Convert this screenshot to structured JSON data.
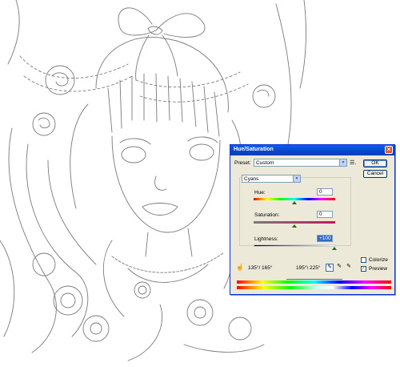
{
  "dialog": {
    "title": "Hue/Saturation",
    "preset_label": "Preset:",
    "preset_value": "Custom",
    "ok_label": "OK",
    "cancel_label": "Cancel",
    "channel_value": "Cyans",
    "hue_label": "Hue:",
    "hue_value": "0",
    "saturation_label": "Saturation:",
    "saturation_value": "0",
    "lightness_label": "Lightness:",
    "lightness_value": "+100",
    "colorize_label": "Colorize",
    "preview_label": "Preview",
    "range_left": "135°/ 165°",
    "range_right": "195°\\ 225°",
    "colorize_checked": false,
    "preview_checked": true
  },
  "icons": {
    "close": "close-icon",
    "hand": "hand-adjust-icon",
    "eyedropper": "eyedropper-icon",
    "eyedropper_plus": "eyedropper-plus-icon",
    "eyedropper_minus": "eyedropper-minus-icon",
    "preset_options": "preset-options-icon"
  },
  "colors": {
    "title_bar": "#0846c8",
    "dialog_bg": "#ece9d8",
    "highlight": "#316ac5"
  }
}
